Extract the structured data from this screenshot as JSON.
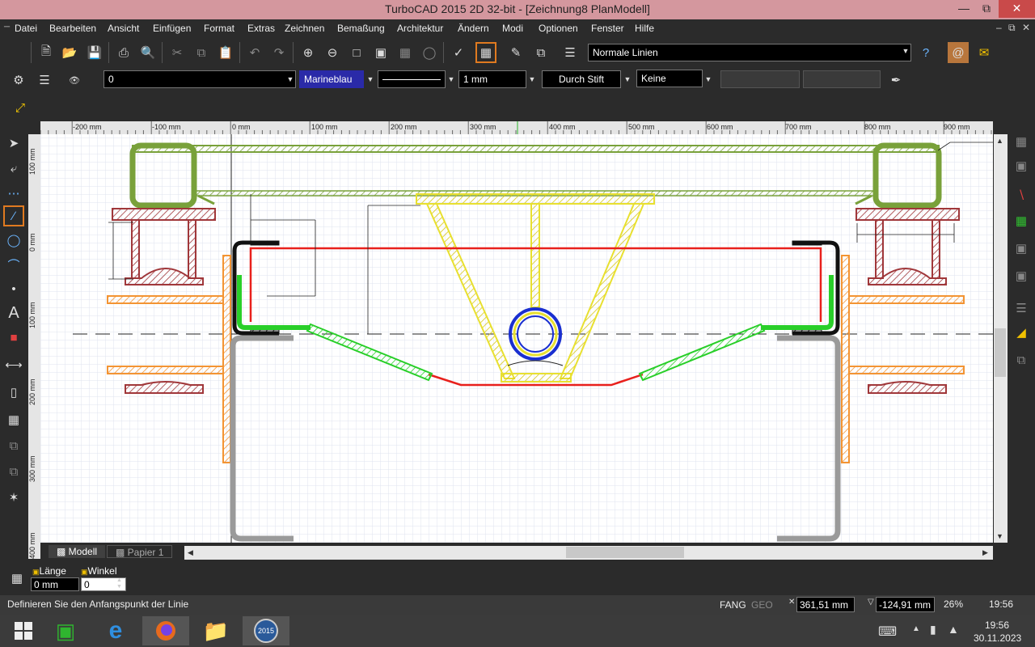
{
  "window": {
    "title": "TurboCAD 2015 2D 32-bit - [Zeichnung8 PlanModell]"
  },
  "menu": [
    "Datei",
    "Bearbeiten",
    "Ansicht",
    "Einfügen",
    "Format",
    "Extras",
    "Zeichnen",
    "Bemaßung",
    "Architektur",
    "Ändern",
    "Modi",
    "Optionen",
    "Fenster",
    "Hilfe"
  ],
  "toolbar": {
    "line_style": "Normale Linien"
  },
  "props": {
    "layer": "0",
    "color": "Marineblau",
    "width": "1 mm",
    "pen": "Durch Stift",
    "fill": "Keine"
  },
  "ruler": {
    "h": [
      "-200 mm",
      "-100 mm",
      "0 mm",
      "100 mm",
      "200 mm",
      "300 mm",
      "400 mm",
      "500 mm",
      "600 mm",
      "700 mm",
      "800 mm",
      "900 mm"
    ],
    "v": [
      "100 mm",
      "0 mm",
      "100 mm",
      "200 mm",
      "300 mm",
      "400 mm"
    ]
  },
  "tabs": {
    "model": "Modell",
    "paper": "Papier 1"
  },
  "inputs": {
    "length_label": "Länge",
    "length_value": "0 mm",
    "angle_label": "Winkel",
    "angle_value": "0"
  },
  "status": {
    "message": "Definieren Sie den Anfangspunkt der Linie",
    "snap": "FANG",
    "geo": "GEO",
    "x": "361,51 mm",
    "y": "-124,91 mm",
    "zoom": "26%",
    "time": "19:56"
  },
  "taskbar": {
    "time": "19:56",
    "date": "30.11.2023",
    "app_badge": "2015"
  },
  "colors": {
    "green": "#79a13a",
    "red": "#a0373a",
    "orange": "#f39433",
    "yellow": "#e8e030",
    "bright_red": "#e8201c",
    "bright_green": "#29cf29",
    "blue": "#1a2fd0",
    "gray": "#9a9a9a"
  }
}
